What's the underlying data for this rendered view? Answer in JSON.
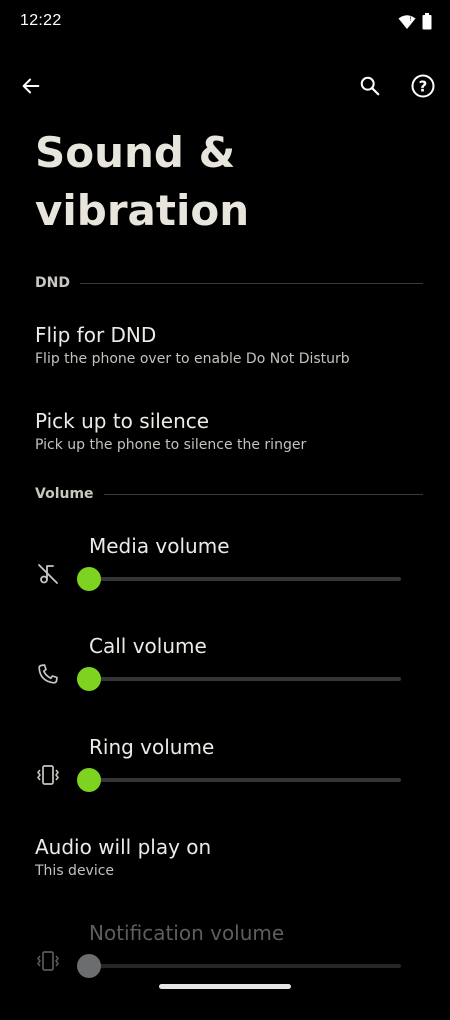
{
  "status_bar": {
    "time": "12:22",
    "icons": [
      "wifi-icon",
      "battery-icon"
    ]
  },
  "top_bar": {
    "back_icon": "arrow-back-icon",
    "search_icon": "search-icon",
    "help_icon": "help-icon"
  },
  "page": {
    "title": "Sound & vibration"
  },
  "sections": {
    "dnd": {
      "label": "DND",
      "items": [
        {
          "title": "Flip for DND",
          "summary": "Flip the phone over to enable Do Not Disturb"
        },
        {
          "title": "Pick up to silence",
          "summary": "Pick up the phone to silence the ringer"
        }
      ]
    },
    "volume": {
      "label": "Volume",
      "sliders": [
        {
          "title": "Media volume",
          "icon": "music-off-icon",
          "level": 0.0,
          "enabled": true
        },
        {
          "title": "Call volume",
          "icon": "phone-icon",
          "level": 0.0,
          "enabled": true
        },
        {
          "title": "Ring volume",
          "icon": "vibrate-icon",
          "level": 0.0,
          "enabled": true
        }
      ],
      "audio_output": {
        "title": "Audio will play on",
        "summary": "This device"
      },
      "notification_slider": {
        "title": "Notification volume",
        "icon": "vibrate-icon",
        "level": 0.0,
        "enabled": false
      }
    }
  },
  "colors": {
    "accent": "#7ed321",
    "background": "#000000",
    "text_primary": "#ecebe6",
    "text_secondary": "#c4c2bc",
    "disabled": "#5e5e5e"
  }
}
